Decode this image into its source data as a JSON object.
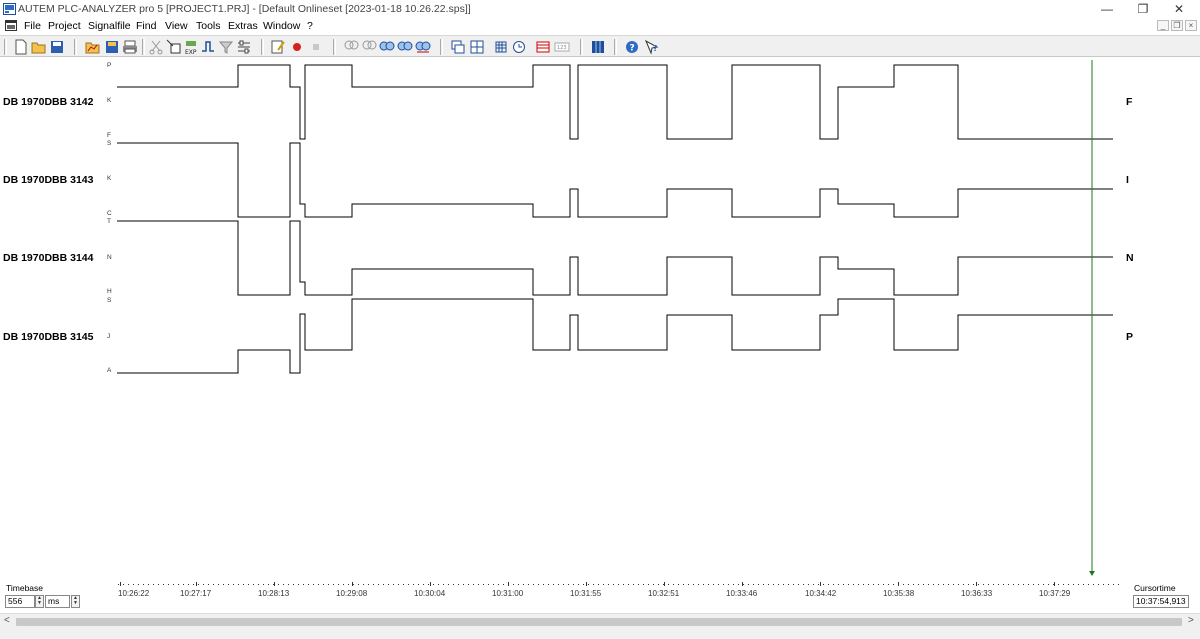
{
  "window": {
    "title": "AUTEM PLC-ANALYZER pro 5 [PROJECT1.PRJ] - [Default Onlineset [2023-01-18 10.26.22.sps]]",
    "minimize_glyph": "—",
    "restore_glyph": "❐",
    "close_glyph": "✕",
    "mdi_min": "_",
    "mdi_restore": "❐",
    "mdi_close": "×"
  },
  "menu": [
    "File",
    "Project",
    "Signalfile",
    "Find",
    "View",
    "Tools",
    "Extras",
    "Window",
    "?"
  ],
  "toolbar_icons": [
    "new-icon",
    "open-icon",
    "save-icon",
    "open-signalfile-icon",
    "save-signalfile-icon",
    "print-icon",
    "cut-icon",
    "import-icon",
    "export-icon",
    "trigger-icon",
    "filter-icon",
    "settings-icon",
    "edit-icon",
    "record-icon",
    "stop-icon",
    "zoom-in-icon",
    "zoom-out-icon",
    "search-prev-icon",
    "search-next-icon",
    "search-all-icon",
    "window-icon",
    "tile-icon",
    "grid-icon",
    "clock-icon",
    "table-icon",
    "number-icon",
    "panel-icon",
    "help-icon",
    "context-help-icon"
  ],
  "signals": [
    {
      "name": "DB 1970DBB 3142",
      "top_label": "P",
      "mid_label": "K",
      "bot_label": "F",
      "end_label": "F"
    },
    {
      "name": "DB 1970DBB 3143",
      "top_label": "S",
      "mid_label": "K",
      "bot_label": "C",
      "end_label": "I"
    },
    {
      "name": "DB 1970DBB 3144",
      "top_label": "T",
      "mid_label": "N",
      "bot_label": "H",
      "end_label": "N"
    },
    {
      "name": "DB 1970DBB 3145",
      "top_label": "S",
      "mid_label": "J",
      "bot_label": "A",
      "end_label": "P"
    }
  ],
  "time_ticks": [
    "10:26:22",
    "10:27:17",
    "10:28:13",
    "10:29:08",
    "10:30:04",
    "10:31:00",
    "10:31:55",
    "10:32:51",
    "10:33:46",
    "10:34:42",
    "10:35:38",
    "10:36:33",
    "10:37:29"
  ],
  "timebase": {
    "label": "Timebase",
    "value": "556",
    "unit": "ms"
  },
  "cursortime": {
    "label": "Cursortime",
    "value": "10:37:54,913"
  },
  "colors": {
    "signal": "#000000",
    "cursor": "#1e7a1e",
    "grid_dots": "#333333"
  }
}
